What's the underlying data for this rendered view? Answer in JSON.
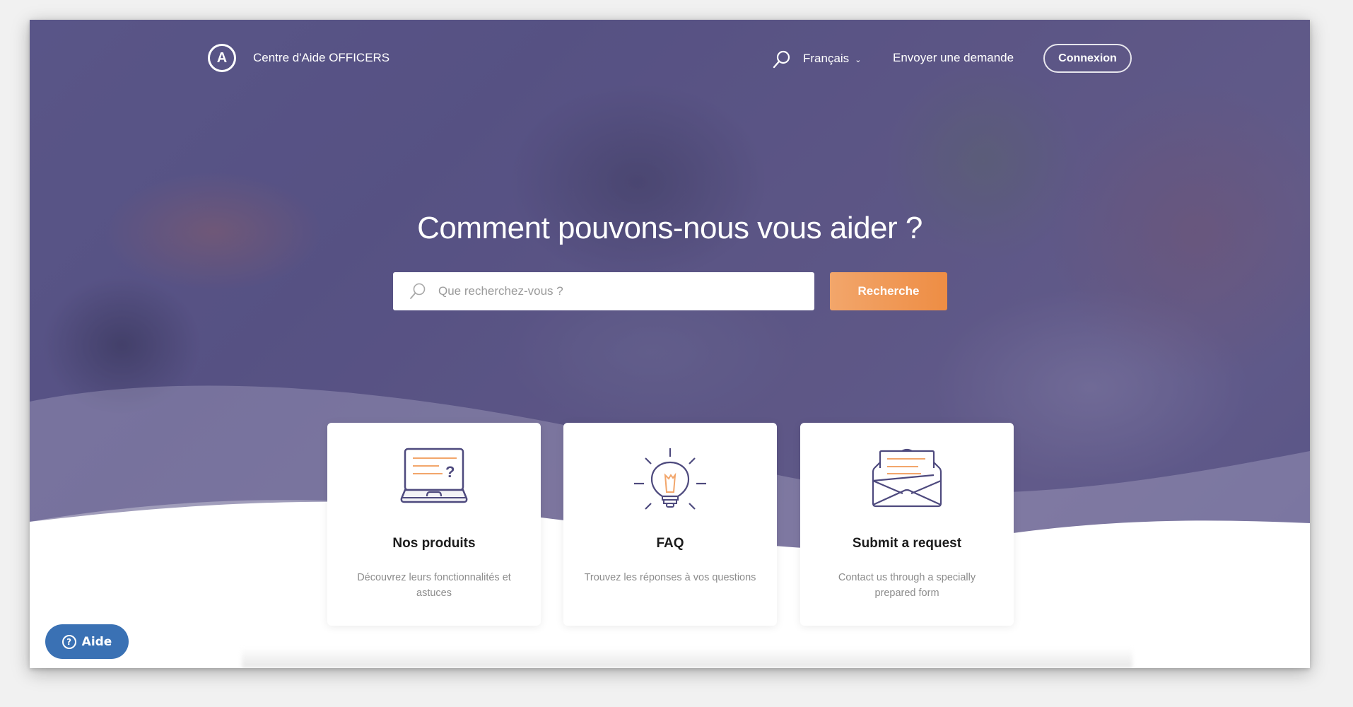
{
  "header": {
    "logo_letter": "A",
    "brand": "Centre d'Aide OFFICERS",
    "language": "Français",
    "submit_link": "Envoyer une demande",
    "login_label": "Connexion"
  },
  "hero": {
    "title": "Comment pouvons-nous vous aider ?",
    "search_placeholder": "Que recherchez-vous ?",
    "search_value": "",
    "search_button": "Recherche"
  },
  "cards": [
    {
      "icon": "laptop-question-icon",
      "title": "Nos produits",
      "description": "Découvrez leurs fonctionnalités et astuces"
    },
    {
      "icon": "lightbulb-icon",
      "title": "FAQ",
      "description": "Trouvez les réponses à vos questions"
    },
    {
      "icon": "envelope-letter-icon",
      "title": "Submit a request",
      "description": "Contact us through a specially prepared form"
    }
  ],
  "help_widget": {
    "label": "Aide",
    "icon": "question-circle-icon"
  },
  "colors": {
    "accent_orange": "#ee8d44",
    "icon_purple": "#4e4a7e",
    "help_blue": "#3a71b4",
    "hero_overlay": "#55508c"
  }
}
